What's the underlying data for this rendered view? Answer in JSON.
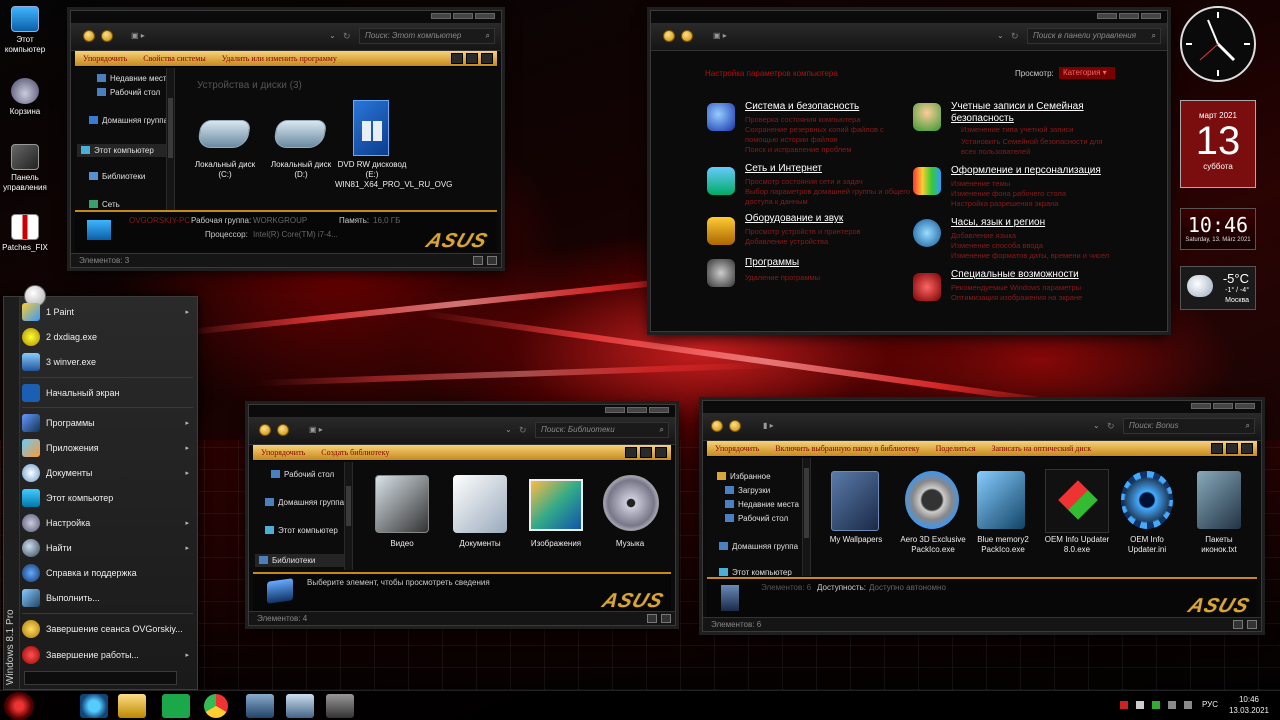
{
  "desktop": {
    "icons": [
      {
        "label": "Этот компьютер",
        "icon": "computer-icon"
      },
      {
        "label": "Корзина",
        "icon": "recycle-bin-icon"
      },
      {
        "label": "Панель управления",
        "icon": "control-panel-icon"
      },
      {
        "label": "Patches_FIX",
        "icon": "patches-icon"
      }
    ]
  },
  "computer_window": {
    "search_placeholder": "Поиск: Этот компьютер",
    "toolbar": {
      "organize": "Упорядочить",
      "system_props": "Свойства системы",
      "uninstall": "Удалить или изменить программу"
    },
    "nav": [
      "Недавние места",
      "Рабочий стол",
      "Домашняя группа",
      "Этот компьютер",
      "Библиотеки",
      "Сеть"
    ],
    "section_title": "Устройства и диски (3)",
    "drives": [
      {
        "label": "Локальный диск (C:)"
      },
      {
        "label": "Локальный диск (D:)"
      },
      {
        "label": "DVD RW дисковод (E:) WIN81_X64_PRO_VL_RU_OVG"
      }
    ],
    "details": {
      "pc_name": "OVGORSKIY-PC",
      "workgroup_label": "Рабочая группа:",
      "workgroup": "WORKGROUP",
      "memory_label": "Память:",
      "memory": "16,0 ГБ",
      "cpu_label": "Процессор:",
      "cpu": "Intel(R) Core(TM) i7-4..."
    },
    "status": "Элементов: 3",
    "brand": "ASUS"
  },
  "control_panel": {
    "search_placeholder": "Поиск в панели управления",
    "heading": "Настройка параметров компьютера",
    "view_label": "Просмотр:",
    "view_value": "Категория",
    "left": [
      {
        "title": "Система и безопасность",
        "subs": [
          "Проверка состояния компьютера",
          "Сохранение резервных копий файлов с помощью истории файлов",
          "Поиск и исправление проблем"
        ]
      },
      {
        "title": "Сеть и Интернет",
        "subs": [
          "Просмотр состояния сети и задач",
          "Выбор параметров домашней группы и общего доступа к данным"
        ]
      },
      {
        "title": "Оборудование и звук",
        "subs": [
          "Просмотр устройств и принтеров",
          "Добавление устройства"
        ]
      },
      {
        "title": "Программы",
        "subs": [
          "Удаление программы"
        ]
      }
    ],
    "right": [
      {
        "title": "Учетные записи и Семейная безопасность",
        "subs": [
          "Изменение типа учетной записи",
          "Установить Семейной безопасности для всех пользователей"
        ]
      },
      {
        "title": "Оформление и персонализация",
        "subs": [
          "Изменение темы",
          "Изменение фона рабочего стола",
          "Настройка разрешения экрана"
        ]
      },
      {
        "title": "Часы, язык и регион",
        "subs": [
          "Добавление языка",
          "Изменение способа ввода",
          "Изменение форматов даты, времени и чисел"
        ]
      },
      {
        "title": "Специальные возможности",
        "subs": [
          "Рекомендуемые Windows параметры",
          "Оптимизация изображения на экране"
        ]
      }
    ]
  },
  "libraries_window": {
    "search_placeholder": "Поиск: Библиотеки",
    "toolbar": {
      "organize": "Упорядочить",
      "create": "Создать библиотеку"
    },
    "nav": [
      "Рабочий стол",
      "Домашняя группа",
      "Этот компьютер",
      "Библиотеки"
    ],
    "items": [
      "Видео",
      "Документы",
      "Изображения",
      "Музыка"
    ],
    "details_text": "Выберите элемент, чтобы просмотреть сведения",
    "status": "Элементов: 4",
    "brand": "ASUS"
  },
  "bonus_window": {
    "search_placeholder": "Поиск: Bonus",
    "toolbar": {
      "organize": "Упорядочить",
      "include": "Включить выбранную папку в библиотеку",
      "share": "Поделиться",
      "burn": "Записать на оптический диск"
    },
    "nav": [
      "Избранное",
      "Загрузки",
      "Недавние места",
      "Рабочий стол",
      "Домашняя группа",
      "Этот компьютер"
    ],
    "items": [
      "My Wallpapers",
      "Aero 3D Exclusive PackIco.exe",
      "Blue memory2 PackIco.exe",
      "OEM Info Updater 8.0.exe",
      "OEM Info Updater.ini",
      "Пакеты иконок.txt"
    ],
    "details": {
      "count": "Элементов: 6",
      "avail_label": "Доступность:",
      "avail": "Доступно автономно"
    },
    "status": "Элементов: 6",
    "brand": "ASUS"
  },
  "start_menu": {
    "recent": [
      {
        "label": "1 Paint",
        "arrow": true
      },
      {
        "label": "2 dxdiag.exe",
        "arrow": false
      },
      {
        "label": "3 winver.exe",
        "arrow": false
      }
    ],
    "start_screen": "Начальный экран",
    "items": [
      {
        "label": "Программы",
        "arrow": true
      },
      {
        "label": "Приложения",
        "arrow": true
      },
      {
        "label": "Документы",
        "arrow": true
      },
      {
        "label": "Этот компьютер",
        "arrow": false
      },
      {
        "label": "Настройка",
        "arrow": true
      },
      {
        "label": "Найти",
        "arrow": true
      },
      {
        "label": "Справка и поддержка",
        "arrow": false
      },
      {
        "label": "Выполнить...",
        "arrow": false
      }
    ],
    "logoff": "Завершение сеанса OVGorskiy...",
    "shutdown": "Завершение работы...",
    "side_text": "Windows 8.1 Pro",
    "arrow_glyph": "▸"
  },
  "gadgets": {
    "calendar": {
      "month": "март 2021",
      "day": "13",
      "weekday": "суббота"
    },
    "digital_clock": {
      "time": "10:46",
      "date": "Saturday, 13. März 2021"
    },
    "weather": {
      "temp": "-5°C",
      "range": "-1° / -4°",
      "city": "Москва"
    }
  },
  "taskbar": {
    "lang": "РУС",
    "time": "10:46",
    "date": "13.03.2021"
  }
}
